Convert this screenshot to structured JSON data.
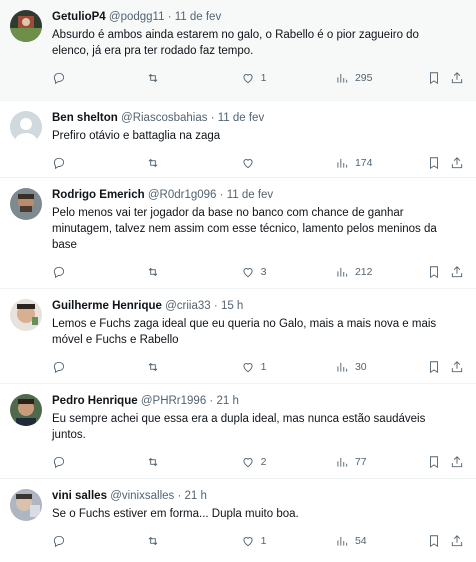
{
  "tweets": [
    {
      "name": "GetulioP4",
      "handle": "@podgg11",
      "sep": "·",
      "time": "11 de fev",
      "text": "Absurdo é ambos ainda estarem no galo, o Rabello é o pior zagueiro do elenco, já era pra ter rodado faz tempo.",
      "likes": "1",
      "views": "295",
      "avatar_color": "#7a4a3a"
    },
    {
      "name": "Ben shelton",
      "handle": "@Riascosbahias",
      "sep": "·",
      "time": "11 de fev",
      "text": "Prefiro otávio e battaglia na zaga",
      "likes": "",
      "views": "174",
      "avatar_color": "#cfd9de"
    },
    {
      "name": "Rodrigo Emerich",
      "handle": "@R0dr1g096",
      "sep": "·",
      "time": "11 de fev",
      "text": "Pelo menos vai ter jogador da base no banco com chance de ganhar minutagem, talvez nem assim com esse técnico, lamento pelos meninos da base",
      "likes": "3",
      "views": "212",
      "avatar_color": "#5b4a3f"
    },
    {
      "name": "Guilherme Henrique",
      "handle": "@criia33",
      "sep": "·",
      "time": "15 h",
      "text": "Lemos e Fuchs zaga ideal que eu queria no Galo, mais a mais nova e mais móvel e Fuchs e Rabello",
      "likes": "1",
      "views": "30",
      "avatar_color": "#c9a58a"
    },
    {
      "name": "Pedro Henrique",
      "handle": "@PHRr1996",
      "sep": "·",
      "time": "21 h",
      "text": "Eu sempre achei que essa era a dupla ideal, mas nunca estão saudáveis juntos.",
      "likes": "2",
      "views": "77",
      "avatar_color": "#3f5a3a"
    },
    {
      "name": "vini salles",
      "handle": "@vinixsalles",
      "sep": "·",
      "time": "21 h",
      "text": "Se o Fuchs estiver em forma... Dupla muito boa.",
      "likes": "1",
      "views": "54",
      "avatar_color": "#8a8f99"
    }
  ]
}
